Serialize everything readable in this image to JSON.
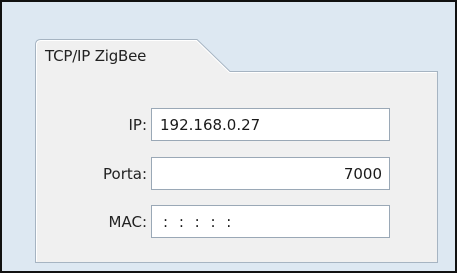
{
  "tab": {
    "label": "TCP/IP ZigBee"
  },
  "fields": {
    "ip": {
      "label": "IP:",
      "value": "192.168.0.27"
    },
    "porta": {
      "label": "Porta:",
      "value": "7000"
    },
    "mac": {
      "label": "MAC:",
      "value": ": : : : :"
    }
  },
  "colors": {
    "frame_background": "#dde8f2",
    "panel_background": "#f0f0f0",
    "panel_border": "#a6b4c2",
    "outer_border": "#111111"
  }
}
